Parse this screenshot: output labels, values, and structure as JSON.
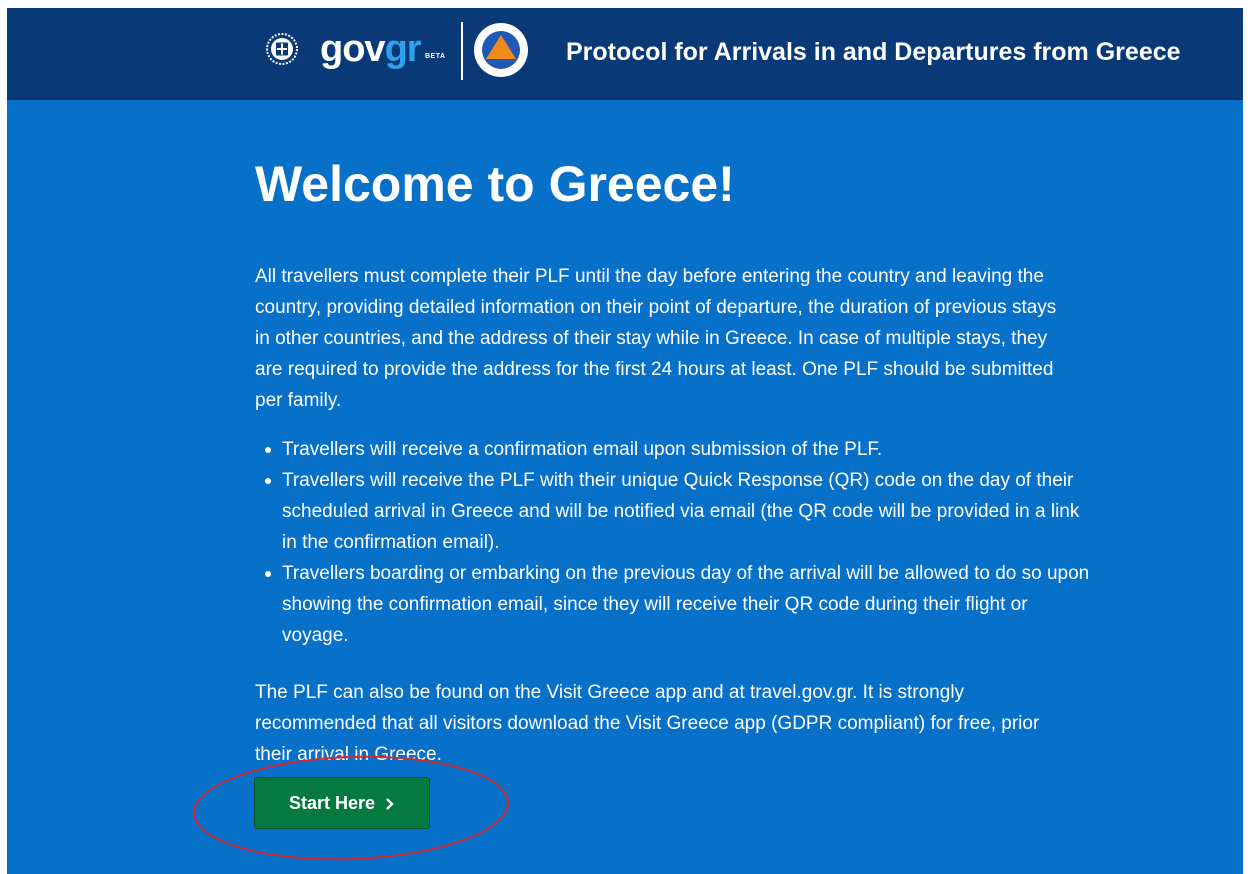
{
  "header": {
    "logo": {
      "gov": "gov",
      "gr": "gr",
      "beta": "BETA"
    },
    "title": "Protocol for Arrivals in and Departures from Greece",
    "emblem_icon": "greek-coat-of-arms-icon",
    "civil_protection_icon": "civil-protection-emblem-icon"
  },
  "main": {
    "heading": "Welcome to Greece!",
    "intro": "All travellers must complete their PLF until the day before entering the country and leaving the country, providing detailed information on their point of departure, the duration of previous stays in other countries, and the address of their stay while in Greece. In case of multiple stays, they are required to provide the address for the first 24 hours at least. One PLF should be submitted per family.",
    "bullets": [
      "Travellers will receive a confirmation email upon submission of the PLF.",
      "Travellers will receive the PLF with their unique Quick Response (QR) code on the day of their scheduled arrival in Greece and will be notified via email (the QR code will be provided in a link in the confirmation email).",
      "Travellers boarding or embarking on the previous day of the arrival will be allowed to do so upon showing the confirmation email, since they will receive their QR code during their flight or voyage."
    ],
    "outro": "The PLF can also be found on the Visit Greece app and at travel.gov.gr. It is strongly recommended that all visitors download the Visit Greece app (GDPR compliant) for free, prior their arrival in Greece.",
    "start_button": {
      "label": "Start Here",
      "icon": "chevron-right-icon"
    }
  },
  "colors": {
    "header_bg": "#0a3978",
    "page_bg": "#0770c8",
    "button_bg": "#047940",
    "logo_accent": "#2fa0ec",
    "highlight": "#d7262e"
  }
}
